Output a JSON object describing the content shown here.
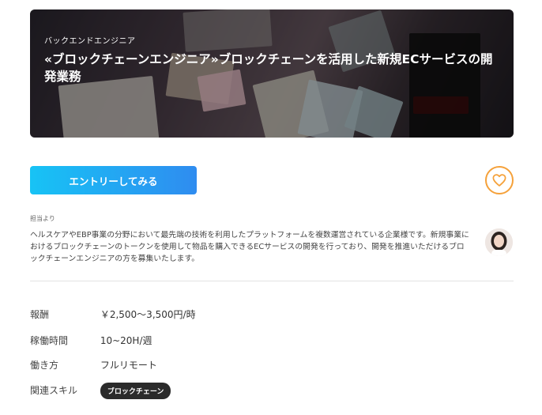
{
  "hero": {
    "category": "バックエンドエンジニア",
    "title": "«ブロックチェーンエンジニア»ブロックチェーンを活用した新規ECサービスの開発業務"
  },
  "actions": {
    "entry_label": "エントリーしてみる",
    "favorite_icon": "heart-icon"
  },
  "message": {
    "from_label": "担当より",
    "text": "ヘルスケアやEBP事業の分野において最先端の技術を利用したプラットフォームを複数運営されている企業様です。新規事業におけるブロックチェーンのトークンを使用して物品を購入できるECサービスの開発を行っており、開発を推進いただけるブロックチェーンエンジニアの方を募集いたします。"
  },
  "details": {
    "reward": {
      "label": "報酬",
      "value": "￥2,500〜3,500円/時"
    },
    "hours": {
      "label": "稼働時間",
      "value": "10~20H/週"
    },
    "workstyle": {
      "label": "働き方",
      "value": "フルリモート"
    },
    "skills": {
      "label": "関連スキル",
      "tags": [
        "ブロックチェーン"
      ]
    }
  },
  "colors": {
    "accent_gradient_start": "#17c3f5",
    "accent_gradient_end": "#2f8cf0",
    "favorite": "#f5a13a"
  }
}
